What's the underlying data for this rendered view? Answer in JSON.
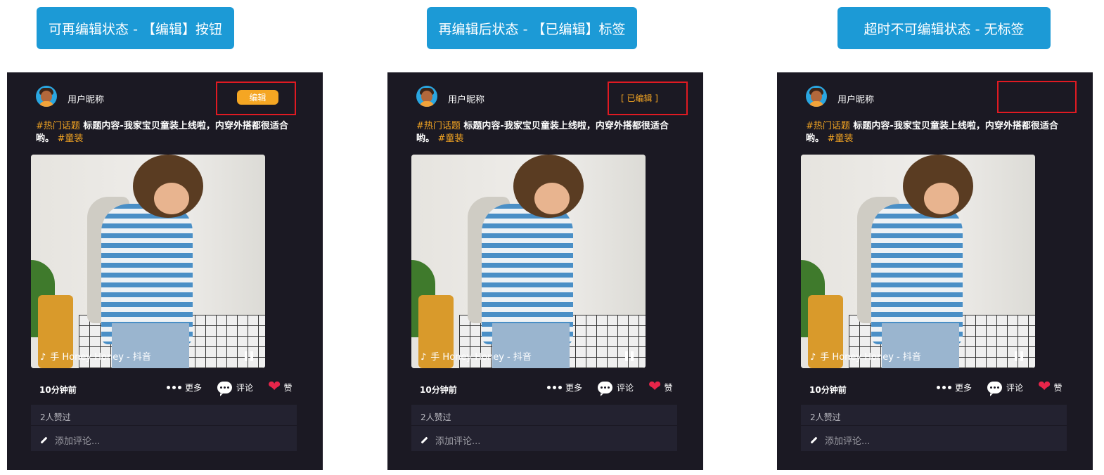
{
  "states": [
    {
      "header": "可再编辑状态 - 【编辑】按钮",
      "edit_button": "编辑",
      "edited_tag": "",
      "card": {
        "username": "用户昵称",
        "caption_tag1": "#热门话题",
        "caption_text": " 标题内容-我家宝贝童装上线啦，内穿外搭都很适合哟。 ",
        "caption_tag2": "#童装",
        "music": "手    Honey Honey - 抖音",
        "time": "10分钟前",
        "more": "更多",
        "comment": "评论",
        "like": "赞",
        "likes_count": "2人赞过",
        "comment_placeholder": "添加评论..."
      }
    },
    {
      "header": "再编辑后状态 - 【已编辑】标签",
      "edit_button": "",
      "edited_tag": "[ 已编辑 ]",
      "card": {
        "username": "用户昵称",
        "caption_tag1": "#热门话题",
        "caption_text": " 标题内容-我家宝贝童装上线啦，内穿外搭都很适合哟。 ",
        "caption_tag2": "#童装",
        "music": "手    Honey Honey - 抖音",
        "time": "10分钟前",
        "more": "更多",
        "comment": "评论",
        "like": "赞",
        "likes_count": "2人赞过",
        "comment_placeholder": "添加评论..."
      }
    },
    {
      "header": "超时不可编辑状态 - 无标签",
      "edit_button": "",
      "edited_tag": "",
      "card": {
        "username": "用户昵称",
        "caption_tag1": "#热门话题",
        "caption_text": " 标题内容-我家宝贝童装上线啦，内穿外搭都很适合哟。 ",
        "caption_tag2": "#童装",
        "music": "手    Honey Honey - 抖音",
        "time": "10分钟前",
        "more": "更多",
        "comment": "评论",
        "like": "赞",
        "likes_count": "2人赞过",
        "comment_placeholder": "添加评论..."
      }
    }
  ],
  "colors": {
    "header_bg": "#1c9ad6",
    "card_bg": "#1b1923",
    "accent_orange": "#f5a623",
    "highlight_red": "#e01a22",
    "like_red": "#e8254a"
  },
  "icons": {
    "music": "tiktok-note-icon",
    "pause": "pause-icon",
    "more": "dots-icon",
    "comment": "chat-bubble-icon",
    "like": "heart-icon",
    "compose": "pencil-icon"
  }
}
